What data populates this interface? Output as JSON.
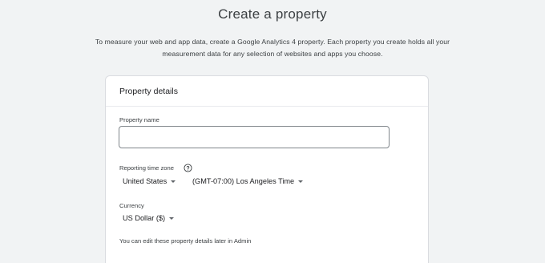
{
  "page": {
    "title": "Create a property",
    "subtitle_line1": "To measure your web and app data, create a Google Analytics 4 property. Each property you create holds all your",
    "subtitle_line2": "measurement data for any selection of websites and apps you choose."
  },
  "card": {
    "header": "Property details",
    "property_name_label": "Property name",
    "property_name_value": "",
    "property_name_placeholder": "",
    "timezone_label": "Reporting time zone",
    "timezone_country": "United States",
    "timezone_zone": "(GMT-07:00) Los Angeles Time",
    "currency_label": "Currency",
    "currency_value": "US Dollar ($)",
    "note": "You can edit these property details later in Admin"
  },
  "icons": {
    "help": "help-circle-icon",
    "caret": "caret-down-icon"
  }
}
